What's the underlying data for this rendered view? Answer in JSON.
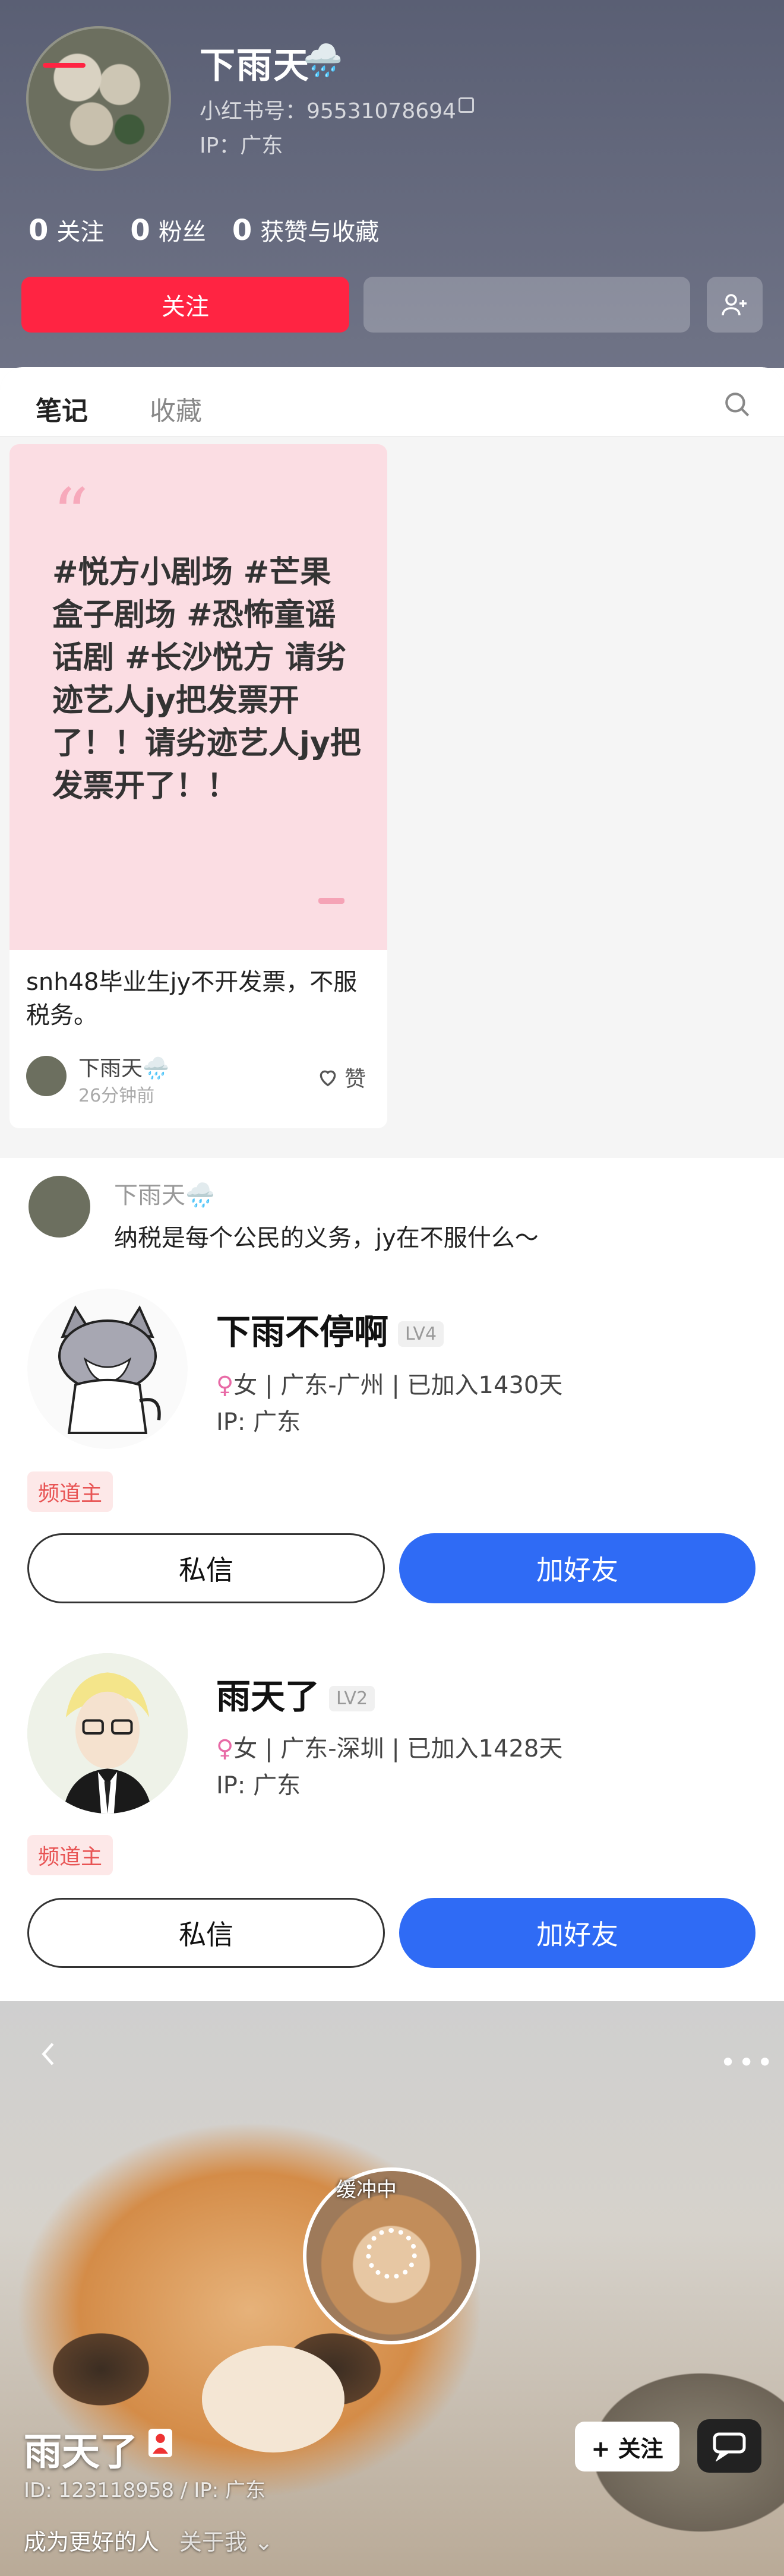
{
  "profile": {
    "username": "下雨天",
    "emoji": "🌧️",
    "red_id": "小红书号：95531078694",
    "ip": "IP：广东",
    "stats": [
      {
        "count": "0",
        "label": "关注"
      },
      {
        "count": "0",
        "label": "粉丝"
      },
      {
        "count": "0",
        "label": "获赞与收藏"
      }
    ],
    "follow_label": "关注",
    "tabs": [
      "笔记",
      "收藏"
    ]
  },
  "note": {
    "quote_mark": "“",
    "cover_text": "#悦方小剧场 #芒果盒子剧场 #恐怖童谣话剧 #长沙悦方 请劣迹艺人jy把发票开了！！请劣迹艺人jy把发票开了！！",
    "title": "snh48毕业生jy不开发票，不服税务。",
    "author": "下雨天🌧️",
    "time": "26分钟前",
    "like_label": "赞"
  },
  "comment": {
    "author": "下雨天🌧️",
    "text": "纳税是每个公民的义务，jy在不服什么～"
  },
  "friends": [
    {
      "name": "下雨不停啊",
      "level": "LV4",
      "gender": "♀",
      "info": "女 | 广东-广州 | 已加入1430天",
      "ip": "IP: 广东",
      "badge": "频道主",
      "pm_label": "私信",
      "add_label": "加好友"
    },
    {
      "name": "雨天了",
      "level": "LV2",
      "gender": "♀",
      "info": "女 | 广东-深圳 | 已加入1428天",
      "ip": "IP: 广东",
      "badge": "频道主",
      "pm_label": "私信",
      "add_label": "加好友"
    }
  ],
  "video_profile": {
    "buffer_text": "缓冲中",
    "name": "雨天了",
    "id_ip": "ID: 123118958 / IP: 广东",
    "follow_label": "+ 关注",
    "signature": "成为更好的人",
    "about": "关于我 ⌄"
  },
  "colors": {
    "brand_red": "#ff2442",
    "friend_blue": "#2f6bf5",
    "badge_red": "#e85454"
  }
}
